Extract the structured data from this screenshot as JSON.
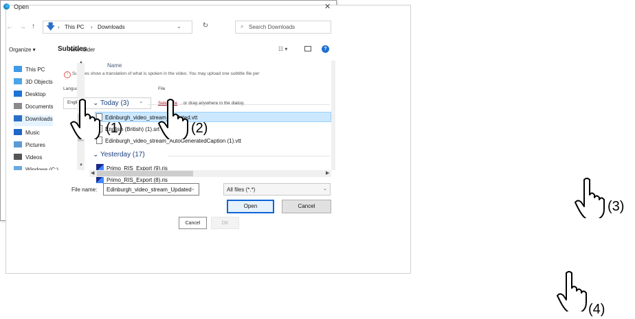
{
  "subtitle_dialog": {
    "title": "Subtitles",
    "info_text": "Subtitles show a translation of what is spoken in the video. You may upload one subtitle file per",
    "language_label": "Language",
    "file_label": "File",
    "language_value": "English",
    "select_file_link": "Select file",
    "drag_text": ", or drag anywhere in the dialog.",
    "cancel_label": "Cancel",
    "ok_label": "OK"
  },
  "open_dialog": {
    "title": "Open",
    "close_glyph": "✕",
    "nav": {
      "back": "←",
      "forward": "→",
      "up": "↑"
    },
    "breadcrumb": [
      "This PC",
      "Downloads"
    ],
    "breadcrumb_separator": "›",
    "refresh_glyph": "↻",
    "search_placeholder": "Search Downloads",
    "toolbar": {
      "organize": "Organize ▾",
      "new_folder": "New folder",
      "view_glyph": "☷ ▾"
    },
    "sidebar": [
      {
        "label": "This PC",
        "icon": "computer-icon",
        "color": "#3f9be8"
      },
      {
        "label": "3D Objects",
        "icon": "cube-icon",
        "color": "#4aa5e8"
      },
      {
        "label": "Desktop",
        "icon": "desktop-icon",
        "color": "#1e73d4"
      },
      {
        "label": "Documents",
        "icon": "document-icon",
        "color": "#8a8a8a"
      },
      {
        "label": "Downloads",
        "icon": "download-icon",
        "color": "#2b6fc9"
      },
      {
        "label": "Music",
        "icon": "music-icon",
        "color": "#1e66c8"
      },
      {
        "label": "Pictures",
        "icon": "pictures-icon",
        "color": "#5a9bd6"
      },
      {
        "label": "Videos",
        "icon": "video-icon",
        "color": "#555555"
      },
      {
        "label": "Windows (C:)",
        "icon": "drive-icon",
        "color": "#6aa8e0"
      }
    ],
    "column_name": "Name",
    "groups": {
      "today": "Today (3)",
      "yesterday": "Yesterday (17)"
    },
    "files_today": [
      "Edinburgh_video_stream_Updated.vtt",
      "English (British) (1).srt",
      "Edinburgh_video_stream_AutoGeneratedCaption (1).vtt"
    ],
    "files_yesterday": [
      "Primo_RIS_Export (9).ris",
      "Primo_RIS_Export (8).ris"
    ],
    "file_name_label": "File name:",
    "file_name_value": "Edinburgh_video_stream_Updated",
    "file_type_value": "All files (*.*)",
    "open_label": "Open",
    "cancel_label": "Cancel",
    "accent_color": "#0a64d6"
  },
  "annotations": {
    "steps": [
      "(1)",
      "(2)",
      "(3)",
      "(4)"
    ]
  }
}
